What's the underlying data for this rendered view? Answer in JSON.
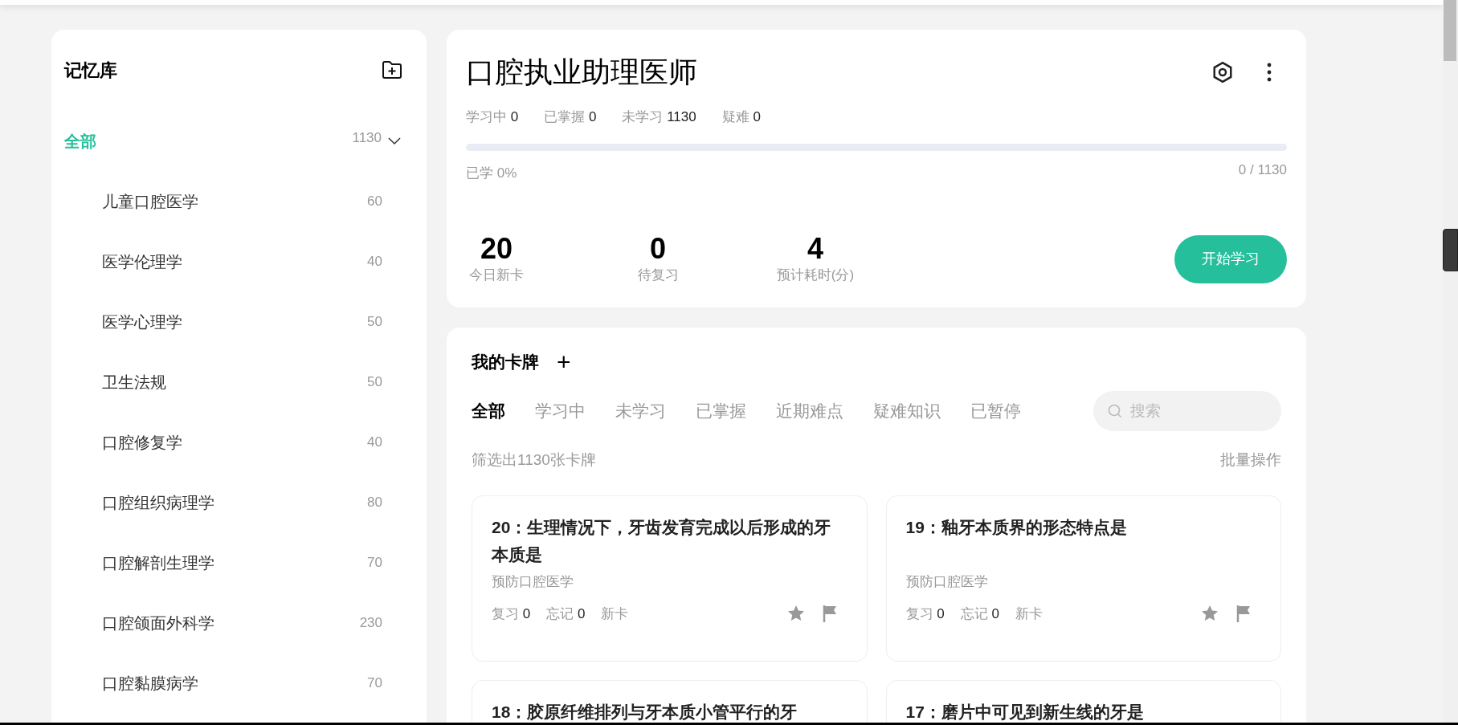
{
  "sidebar": {
    "title": "记忆库",
    "items": [
      {
        "label": "全部",
        "count": "1130",
        "selected": true,
        "expanded": true,
        "children": [
          {
            "label": "儿童口腔医学",
            "count": "60",
            "selected": false
          },
          {
            "label": "医学伦理学",
            "count": "40",
            "selected": false
          },
          {
            "label": "医学心理学",
            "count": "50",
            "selected": false
          },
          {
            "label": "卫生法规",
            "count": "50",
            "selected": false
          },
          {
            "label": "口腔修复学",
            "count": "40",
            "selected": false
          },
          {
            "label": "口腔组织病理学",
            "count": "80",
            "selected": false
          },
          {
            "label": "口腔解剖生理学",
            "count": "70",
            "selected": false
          },
          {
            "label": "口腔颌面外科学",
            "count": "230",
            "selected": false
          },
          {
            "label": "口腔黏膜病学",
            "count": "70",
            "selected": false
          }
        ]
      }
    ]
  },
  "deck": {
    "title": "口腔执业助理医师",
    "stats": [
      {
        "label": "学习中",
        "value": "0"
      },
      {
        "label": "已掌握",
        "value": "0"
      },
      {
        "label": "未学习",
        "value": "1130"
      },
      {
        "label": "疑难",
        "value": "0"
      }
    ],
    "progress": {
      "level": 0,
      "label": "已学 0%",
      "reading": "0 / 1130"
    },
    "summary": [
      {
        "value": "20",
        "label": "今日新卡"
      },
      {
        "value": "0",
        "label": "待复习"
      },
      {
        "value": "4",
        "label": "预计耗时(分)"
      }
    ],
    "start_button": "开始学习"
  },
  "cards_panel": {
    "title": "我的卡牌",
    "add": "+",
    "tabs": [
      {
        "label": "全部",
        "selected": true
      },
      {
        "label": "学习中",
        "selected": false
      },
      {
        "label": "未学习",
        "selected": false
      },
      {
        "label": "已掌握",
        "selected": false
      },
      {
        "label": "近期难点",
        "selected": false
      },
      {
        "label": "疑难知识",
        "selected": false
      },
      {
        "label": "已暂停",
        "selected": false
      }
    ],
    "search": {
      "placeholder": "搜索"
    },
    "filter_text": "筛选出1130张卡牌",
    "batch": "批量操作",
    "cards": [
      {
        "title": "20：生理情况下，牙齿发育完成以后形成的牙本质是",
        "subject": "预防口腔医学",
        "review": "复习",
        "review_count": "0",
        "forget": "忘记",
        "forget_count": "0",
        "status": "新卡"
      },
      {
        "title": "19：釉牙本质界的形态特点是",
        "subject": "预防口腔医学",
        "review": "复习",
        "review_count": "0",
        "forget": "忘记",
        "forget_count": "0",
        "status": "新卡"
      },
      {
        "title": "18：胶原纤维排列与牙本质小管平行的牙"
      },
      {
        "title": "17：磨片中可见到新生线的牙是"
      }
    ]
  }
}
